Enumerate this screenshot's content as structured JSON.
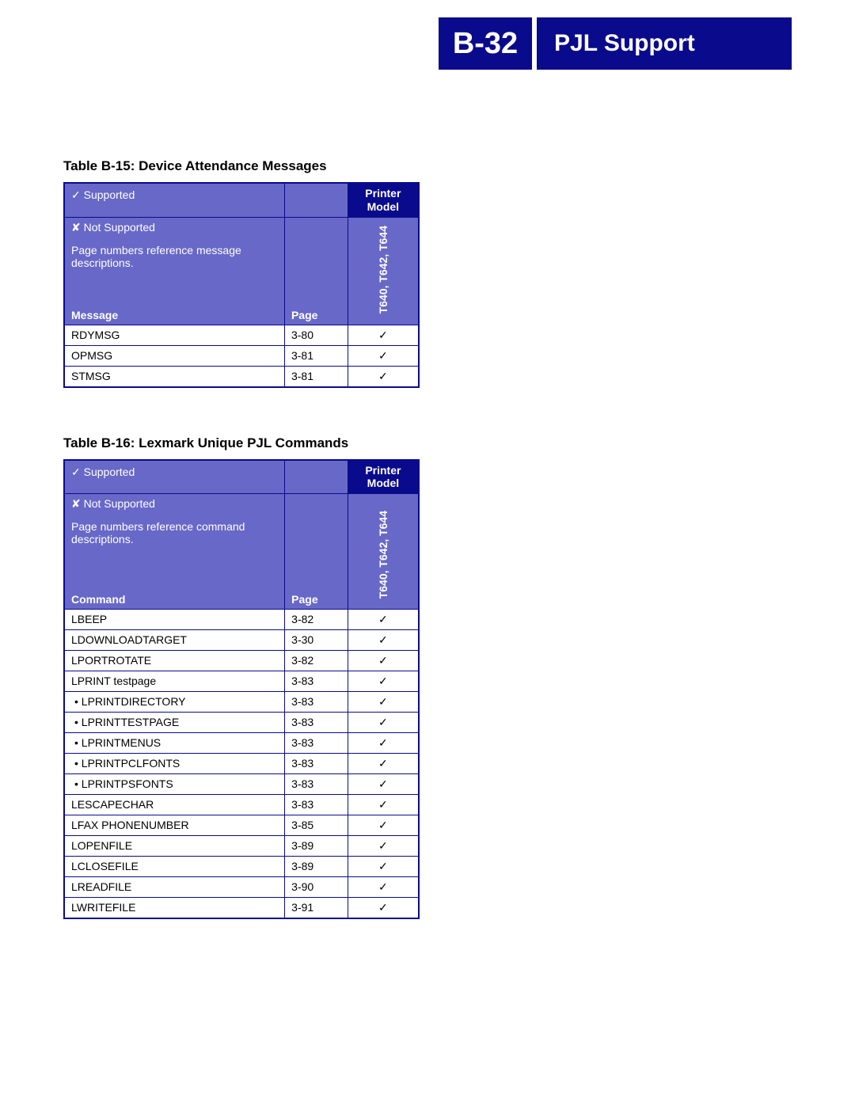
{
  "header": {
    "page_number": "B-32",
    "title": "PJL Support"
  },
  "legend": {
    "supported": "✓ Supported",
    "not_supported": "✘ Not Supported",
    "note_messages": "Page numbers reference message descriptions.",
    "note_commands": "Page numbers reference command descriptions.",
    "printer_model_label": "Printer Model",
    "model_column": "T640, T642, T644"
  },
  "table1": {
    "title": "Table B-15:  Device Attendance Messages",
    "col1_label": "Message",
    "col2_label": "Page",
    "rows": [
      {
        "name": "RDYMSG",
        "page": "3-80",
        "support": "✓"
      },
      {
        "name": "OPMSG",
        "page": "3-81",
        "support": "✓"
      },
      {
        "name": "STMSG",
        "page": "3-81",
        "support": "✓"
      }
    ]
  },
  "table2": {
    "title": "Table B-16:  Lexmark Unique PJL Commands",
    "col1_label": "Command",
    "col2_label": "Page",
    "rows": [
      {
        "name": "LBEEP",
        "page": "3-82",
        "support": "✓",
        "bullet": false
      },
      {
        "name": "LDOWNLOADTARGET",
        "page": "3-30",
        "support": "✓",
        "bullet": false
      },
      {
        "name": "LPORTROTATE",
        "page": "3-82",
        "support": "✓",
        "bullet": false
      },
      {
        "name": "LPRINT testpage",
        "page": "3-83",
        "support": "✓",
        "bullet": false
      },
      {
        "name": "•  LPRINTDIRECTORY",
        "page": "3-83",
        "support": "✓",
        "bullet": true
      },
      {
        "name": "•  LPRINTTESTPAGE",
        "page": "3-83",
        "support": "✓",
        "bullet": true
      },
      {
        "name": "•  LPRINTMENUS",
        "page": "3-83",
        "support": "✓",
        "bullet": true
      },
      {
        "name": "•  LPRINTPCLFONTS",
        "page": "3-83",
        "support": "✓",
        "bullet": true
      },
      {
        "name": "•  LPRINTPSFONTS",
        "page": "3-83",
        "support": "✓",
        "bullet": true
      },
      {
        "name": "LESCAPECHAR",
        "page": "3-83",
        "support": "✓",
        "bullet": false
      },
      {
        "name": "LFAX PHONENUMBER",
        "page": "3-85",
        "support": "✓",
        "bullet": false
      },
      {
        "name": "LOPENFILE",
        "page": "3-89",
        "support": "✓",
        "bullet": false
      },
      {
        "name": "LCLOSEFILE",
        "page": "3-89",
        "support": "✓",
        "bullet": false
      },
      {
        "name": "LREADFILE",
        "page": "3-90",
        "support": "✓",
        "bullet": false
      },
      {
        "name": "LWRITEFILE",
        "page": "3-91",
        "support": "✓",
        "bullet": false
      }
    ]
  }
}
